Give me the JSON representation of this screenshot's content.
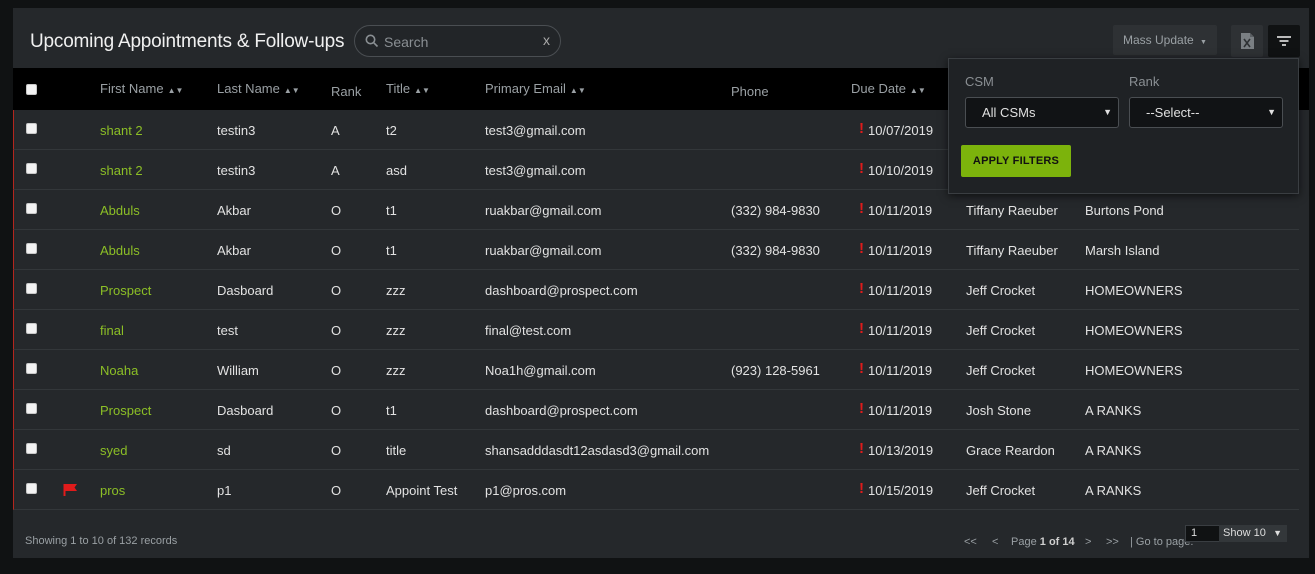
{
  "header": {
    "title": "Upcoming Appointments & Follow-ups",
    "search_placeholder": "Search",
    "clear_label": "x",
    "mass_update_label": "Mass Update"
  },
  "columns": {
    "first_name": "First Name",
    "last_name": "Last Name",
    "rank": "Rank",
    "title": "Title",
    "primary_email": "Primary Email",
    "phone": "Phone",
    "due_date": "Due Date"
  },
  "rows": [
    {
      "first": "shant 2",
      "last": "testin3",
      "rank": "A",
      "title": "t2",
      "email": "test3@gmail.com",
      "phone": "",
      "due": "10/07/2019",
      "csm": "",
      "company": "",
      "flagged": false
    },
    {
      "first": "shant 2",
      "last": "testin3",
      "rank": "A",
      "title": "asd",
      "email": "test3@gmail.com",
      "phone": "",
      "due": "10/10/2019",
      "csm": "",
      "company": "",
      "flagged": false
    },
    {
      "first": "Abduls",
      "last": "Akbar",
      "rank": "O",
      "title": "t1",
      "email": "ruakbar@gmail.com",
      "phone": "(332) 984-9830",
      "due": "10/11/2019",
      "csm": "Tiffany Raeuber",
      "company": "Burtons Pond",
      "flagged": false
    },
    {
      "first": "Abduls",
      "last": "Akbar",
      "rank": "O",
      "title": "t1",
      "email": "ruakbar@gmail.com",
      "phone": "(332) 984-9830",
      "due": "10/11/2019",
      "csm": "Tiffany Raeuber",
      "company": "Marsh Island",
      "flagged": false
    },
    {
      "first": "Prospect",
      "last": "Dasboard",
      "rank": "O",
      "title": "zzz",
      "email": "dashboard@prospect.com",
      "phone": "",
      "due": "10/11/2019",
      "csm": "Jeff Crocket",
      "company": "HOMEOWNERS",
      "flagged": false
    },
    {
      "first": "final",
      "last": "test",
      "rank": "O",
      "title": "zzz",
      "email": "final@test.com",
      "phone": "",
      "due": "10/11/2019",
      "csm": "Jeff Crocket",
      "company": "HOMEOWNERS",
      "flagged": false
    },
    {
      "first": "Noaha",
      "last": "William",
      "rank": "O",
      "title": "zzz",
      "email": "Noa1h@gmail.com",
      "phone": "(923) 128-5961",
      "due": "10/11/2019",
      "csm": "Jeff Crocket",
      "company": "HOMEOWNERS",
      "flagged": false
    },
    {
      "first": "Prospect",
      "last": "Dasboard",
      "rank": "O",
      "title": "t1",
      "email": "dashboard@prospect.com",
      "phone": "",
      "due": "10/11/2019",
      "csm": "Josh Stone",
      "company": "A RANKS",
      "flagged": false
    },
    {
      "first": "syed",
      "last": "sd",
      "rank": "O",
      "title": "title",
      "email": "shansadddasdt12asdasd3@gmail.com",
      "phone": "",
      "due": "10/13/2019",
      "csm": "Grace Reardon",
      "company": "A RANKS",
      "flagged": false
    },
    {
      "first": "pros",
      "last": "p1",
      "rank": "O",
      "title": "Appoint Test",
      "email": "p1@pros.com",
      "phone": "",
      "due": "10/15/2019",
      "csm": "Jeff Crocket",
      "company": "A RANKS",
      "flagged": true
    }
  ],
  "footer": {
    "showing": "Showing 1 to 10 of 132 records",
    "first": "<<",
    "prev": "<",
    "page_prefix": "Page",
    "page_current": "1 of 14",
    "next": ">",
    "last": ">>",
    "goto_label": "| Go to page:",
    "goto_value": "1",
    "show_label": "Show 10"
  },
  "filters": {
    "csm_label": "CSM",
    "csm_value": "All CSMs",
    "rank_label": "Rank",
    "rank_value": "--Select--",
    "apply_label": "APPLY FILTERS"
  },
  "colors": {
    "accent_green": "#8cbf26",
    "apply_button": "#7cb30c",
    "due_alert": "#e01b1b",
    "flag": "#e01b1b"
  },
  "icons": {
    "search": "search-icon",
    "excel": "excel-export-icon",
    "filter": "filter-icon",
    "flag": "flag-icon",
    "due": "exclamation-icon"
  }
}
